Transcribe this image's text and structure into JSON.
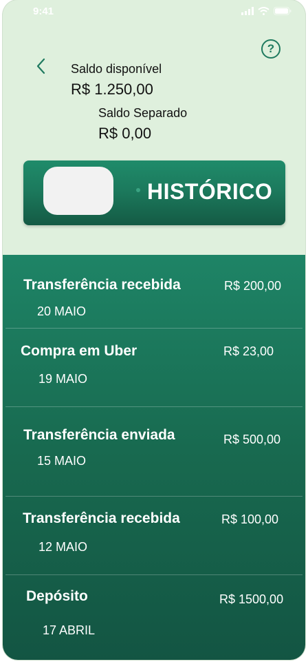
{
  "status_bar": {
    "time": "9:41"
  },
  "header": {
    "available_label": "Saldo disponível",
    "available_value": "R$ 1.250,00",
    "separate_label": "Saldo Separado",
    "separate_value": "R$ 0,00",
    "help_symbol": "?"
  },
  "toggle": {
    "label": "HISTÓRICO"
  },
  "transactions": [
    {
      "title": "Transferência recebida",
      "date": "20 MAIO",
      "amount": "R$ 200,00"
    },
    {
      "title": "Compra em Uber",
      "date": "19 MAIO",
      "amount": "R$ 23,00"
    },
    {
      "title": "Transferência enviada",
      "date": "15 MAIO",
      "amount": "R$ 500,00"
    },
    {
      "title": "Transferência recebida",
      "date": "12 MAIO",
      "amount": "R$ 100,00"
    },
    {
      "title": "Depósito",
      "date": "17 ABRIL",
      "amount": "R$ 1500,00"
    }
  ],
  "colors": {
    "background": "#dff0dd",
    "accent": "#1f7a5f",
    "list_top": "#1e8466",
    "list_bottom": "#135543"
  }
}
